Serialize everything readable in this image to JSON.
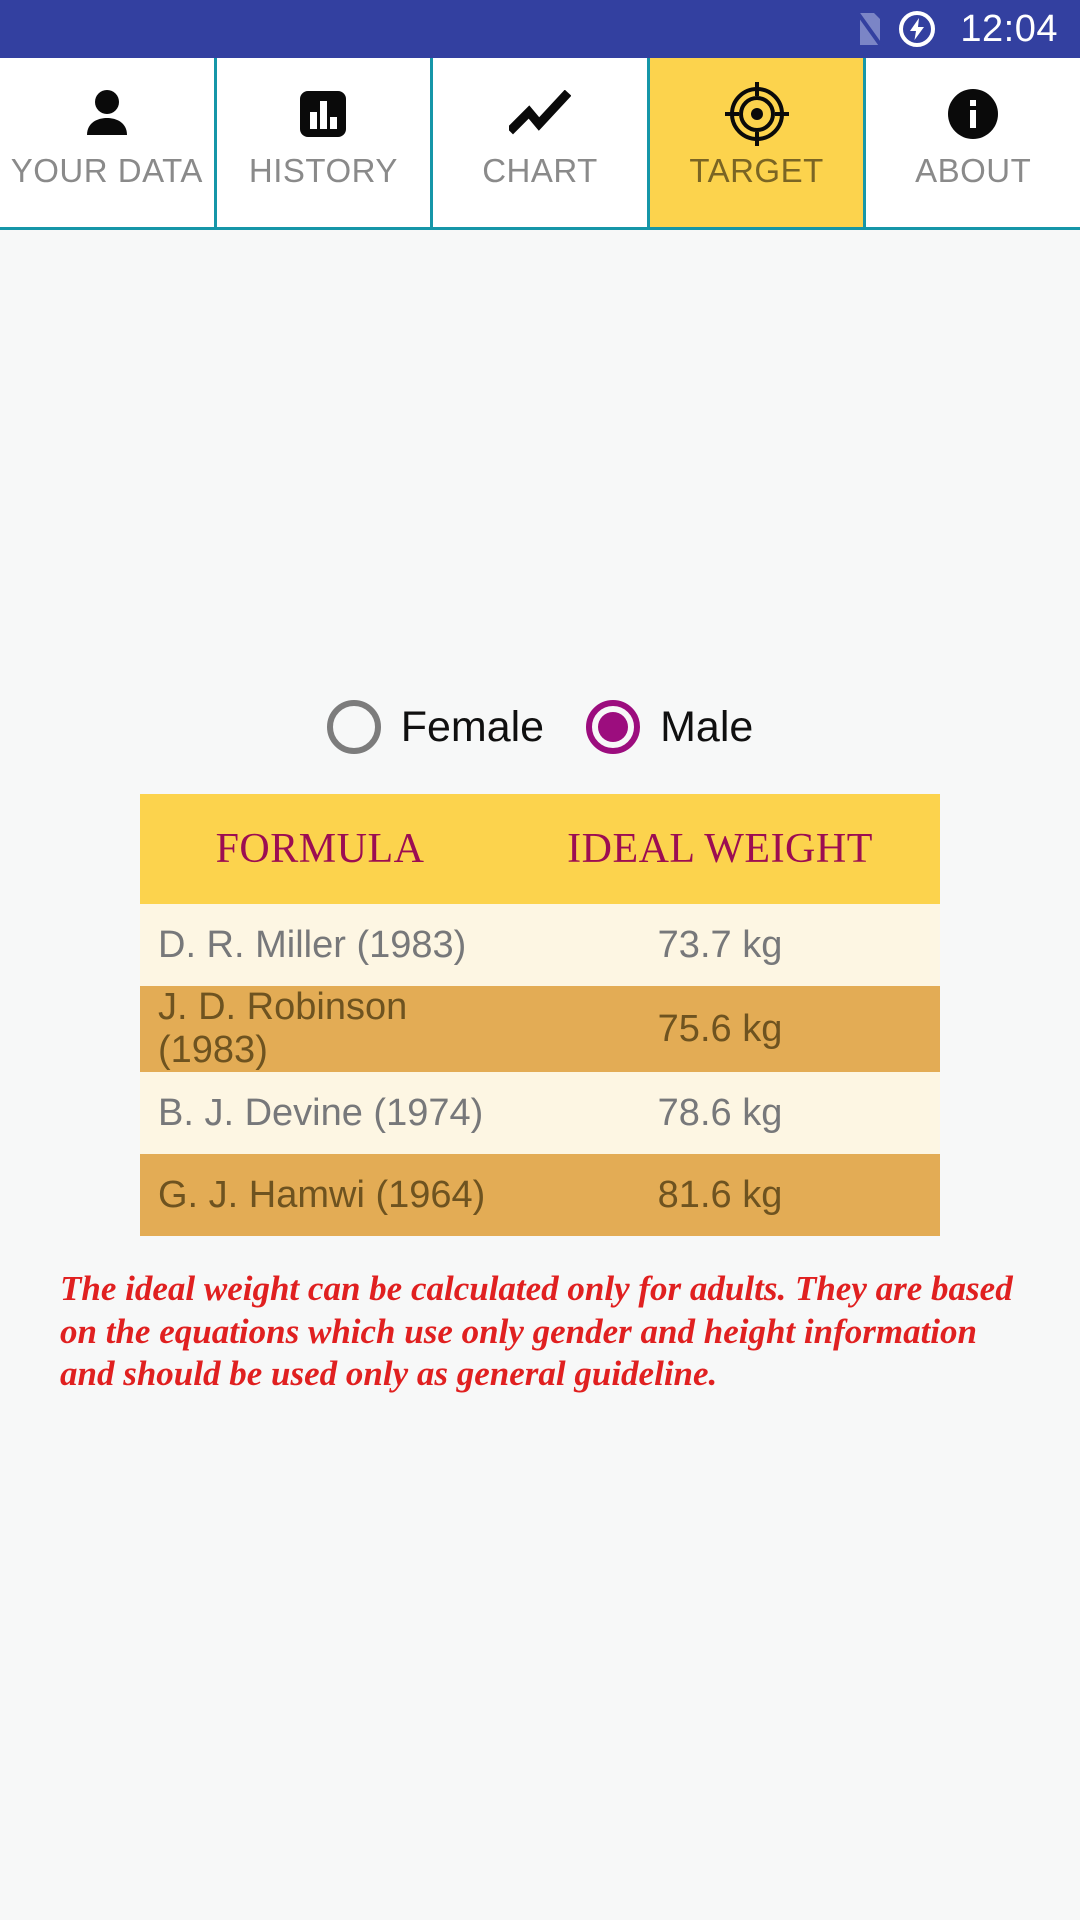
{
  "status_bar": {
    "time": "12:04",
    "icons": [
      "sim-off-icon",
      "charging-bolt-icon"
    ],
    "background_color": "#3340A0"
  },
  "tabs": [
    {
      "label": "YOUR DATA",
      "icon": "person-icon",
      "active": false
    },
    {
      "label": "HISTORY",
      "icon": "bar-chart-icon",
      "active": false
    },
    {
      "label": "CHART",
      "icon": "line-chart-icon",
      "active": false
    },
    {
      "label": "TARGET",
      "icon": "target-crosshair-icon",
      "active": true
    },
    {
      "label": "ABOUT",
      "icon": "info-circle-icon",
      "active": false
    }
  ],
  "gender": {
    "options": [
      {
        "label": "Female",
        "selected": false
      },
      {
        "label": "Male",
        "selected": true
      }
    ],
    "selected_color": "#9C0D7E",
    "unselected_color": "#7C7C7C"
  },
  "table": {
    "headers": [
      "FORMULA",
      "IDEAL WEIGHT"
    ],
    "rows": [
      {
        "formula": "D. R. Miller (1983)",
        "weight": "73.7 kg"
      },
      {
        "formula": "J. D. Robinson (1983)",
        "weight": "75.6 kg"
      },
      {
        "formula": "B. J. Devine (1974)",
        "weight": "78.6 kg"
      },
      {
        "formula": "G. J. Hamwi (1964)",
        "weight": "81.6 kg"
      }
    ],
    "header_bg": "#FCD34D",
    "header_text_color": "#9C0D52",
    "row_odd_bg": "#FDF6E3",
    "row_even_bg": "#E3AC55"
  },
  "disclaimer": {
    "text": "The ideal weight can be calculated only for adults. They are based on the equations which use only gender and height information and should be used only as general guideline.",
    "color": "#E02020"
  }
}
